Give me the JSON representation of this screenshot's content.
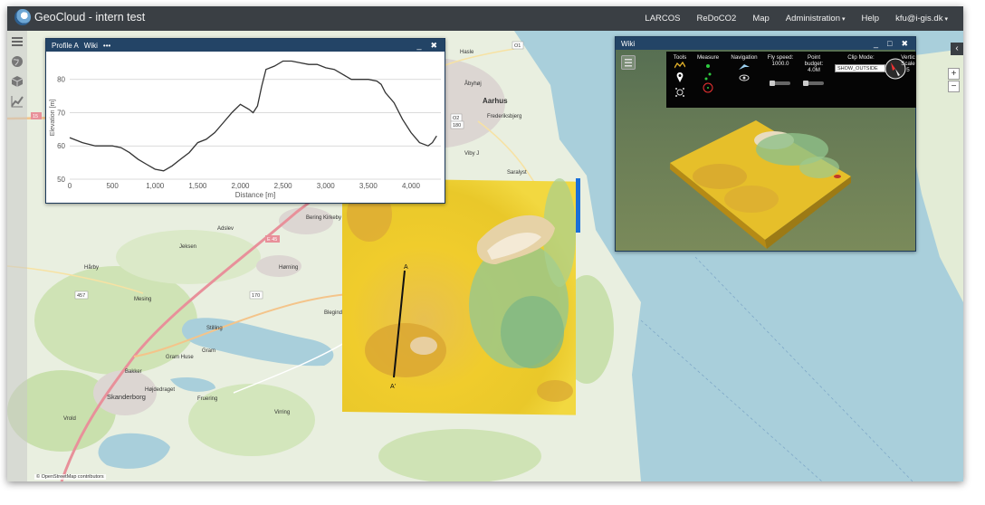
{
  "app": {
    "title": "GeoCloud - intern test"
  },
  "nav": {
    "items": [
      {
        "label": "LARCOS"
      },
      {
        "label": "ReDoCO2"
      },
      {
        "label": "Map"
      },
      {
        "label": "Administration",
        "caret": "▾"
      },
      {
        "label": "Help"
      },
      {
        "label": "kfu@i-gis.dk",
        "caret": "▾"
      }
    ]
  },
  "sidebar": {
    "icons": [
      "layers-icon",
      "globe-icon",
      "cube-icon",
      "chart-icon"
    ]
  },
  "map": {
    "attribution": "© OpenStreetMap contributors",
    "places": [
      {
        "name": "Aarhus"
      },
      {
        "name": "Hasle"
      },
      {
        "name": "Åbyhøj"
      },
      {
        "name": "Frederiksbjerg"
      },
      {
        "name": "Viby J"
      },
      {
        "name": "Saralyst"
      },
      {
        "name": "Bering Kirkeby"
      },
      {
        "name": "Hørning"
      },
      {
        "name": "Adslev"
      },
      {
        "name": "Jeksen"
      },
      {
        "name": "Hårby"
      },
      {
        "name": "Mesing"
      },
      {
        "name": "Stilling"
      },
      {
        "name": "Gram"
      },
      {
        "name": "Gram Huse"
      },
      {
        "name": "Skanderborg"
      },
      {
        "name": "Bakker"
      },
      {
        "name": "Højdedraget"
      },
      {
        "name": "Fruering"
      },
      {
        "name": "Vrold"
      },
      {
        "name": "Virring"
      },
      {
        "name": "Blegind"
      }
    ],
    "roads": [
      {
        "name": "E 45"
      },
      {
        "name": "457"
      },
      {
        "name": "170"
      },
      {
        "name": "15"
      },
      {
        "name": "O1"
      },
      {
        "name": "O2"
      },
      {
        "name": "180"
      }
    ],
    "profile_markers": {
      "start": "A",
      "end": "A'"
    },
    "zoom_in": "+",
    "zoom_out": "−",
    "collapse": "‹"
  },
  "profile_window": {
    "title": "Profile A",
    "tab": "Wiki",
    "more": "•••",
    "minimize": "_",
    "close": "✖"
  },
  "chart_data": {
    "type": "line",
    "title": "",
    "xlabel": "Distance [m]",
    "ylabel": "Elevation [m]",
    "xlim": [
      0,
      4350
    ],
    "ylim": [
      50,
      87
    ],
    "xticks": [
      0,
      500,
      1000,
      1500,
      2000,
      2500,
      3000,
      3500,
      4000
    ],
    "xtick_labels": [
      "0",
      "500",
      "1,000",
      "1,500",
      "2,000",
      "2,500",
      "3,000",
      "3,500",
      "4,000"
    ],
    "yticks": [
      50,
      60,
      70,
      80
    ],
    "grid": true,
    "series": [
      {
        "color": "#333333",
        "x": [
          0,
          150,
          300,
          500,
          600,
          700,
          800,
          900,
          1000,
          1100,
          1200,
          1300,
          1400,
          1500,
          1600,
          1700,
          1800,
          1900,
          2000,
          2100,
          2150,
          2200,
          2250,
          2300,
          2350,
          2400,
          2500,
          2600,
          2700,
          2800,
          2900,
          3000,
          3100,
          3200,
          3300,
          3400,
          3500,
          3600,
          3650,
          3700,
          3800,
          3900,
          4000,
          4100,
          4200,
          4250,
          4300
        ],
        "y": [
          62.5,
          61,
          60,
          60,
          59.5,
          58,
          56,
          54.5,
          53,
          52.5,
          54,
          56,
          58,
          61,
          62,
          64,
          67,
          70,
          72.5,
          71,
          70,
          72,
          78,
          83,
          83.5,
          84,
          85.5,
          85.5,
          85,
          84.5,
          84.5,
          83.5,
          83,
          81.5,
          80,
          80,
          80,
          79.5,
          78.5,
          76,
          73,
          68,
          64,
          61,
          60,
          61,
          63
        ]
      }
    ]
  },
  "wiki_window": {
    "title": "Wiki",
    "minimize": "_",
    "maximize": "□",
    "close": "✖",
    "toolbar": {
      "tools": "Tools",
      "measure": "Measure",
      "navigation": "Navigation",
      "fly_speed_label": "Fly speed:",
      "fly_speed_value": "1000.0",
      "point_budget_label": "Point budget:",
      "point_budget_value": "4.0M",
      "clip_mode_label": "Clip Mode:",
      "clip_mode_value": "SHOW_OUTSIDE",
      "vertical_scale_label": "Vertic Scale",
      "vertical_scale_value": "5"
    }
  }
}
